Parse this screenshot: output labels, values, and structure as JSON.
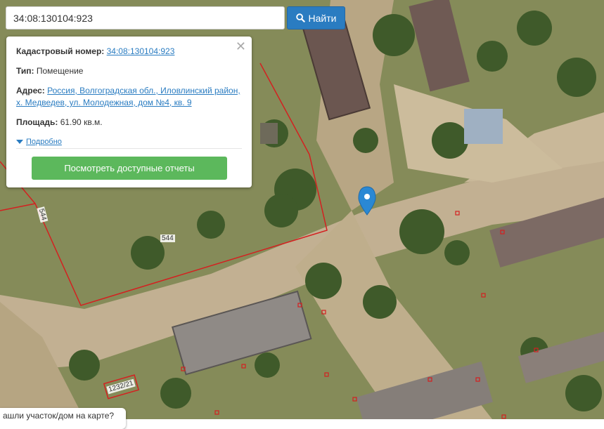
{
  "search": {
    "value": "34:08:130104:923",
    "button_label": "Найти"
  },
  "popup": {
    "cadastral_label": "Кадастровый номер:",
    "cadastral_value": "34:08:130104:923",
    "type_label": "Тип:",
    "type_value": "Помещение",
    "address_label": "Адрес:",
    "address_line1": "Россия, Волгоградская обл., Иловлинский район,",
    "address_line2": "х. Медведев, ул. Молодежная, дом №4, кв. 9",
    "area_label": "Площадь:",
    "area_value": "61.90 кв.м.",
    "more_label": "Подробно",
    "report_button": "Посмотреть доступные отчеты"
  },
  "map": {
    "parcel_labels": [
      "544",
      "544",
      "1232/21"
    ],
    "marker_color": "#2a88d4",
    "parcel_line_color": "#d42020"
  },
  "bottom_bubble": {
    "text": "ашли участок/дом на карте?"
  }
}
